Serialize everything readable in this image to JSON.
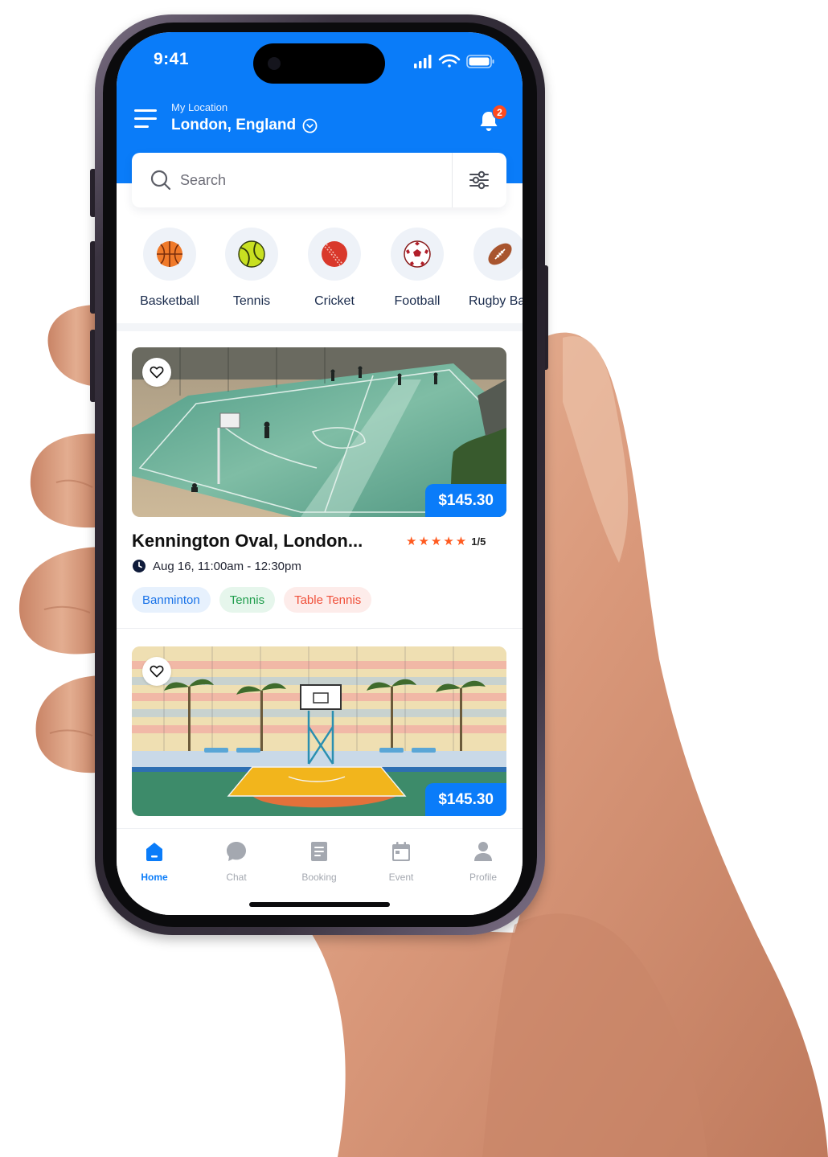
{
  "status_bar": {
    "time": "9:41"
  },
  "header": {
    "location_label": "My Location",
    "location_value": "London, England",
    "notification_count": "2"
  },
  "search": {
    "placeholder": "Search"
  },
  "categories": [
    {
      "label": "Basketball",
      "icon": "basketball-icon"
    },
    {
      "label": "Tennis",
      "icon": "tennis-ball-icon"
    },
    {
      "label": "Cricket",
      "icon": "cricket-ball-icon"
    },
    {
      "label": "Football",
      "icon": "football-icon"
    },
    {
      "label": "Rugby Ba",
      "icon": "rugby-ball-icon"
    }
  ],
  "venues": [
    {
      "price": "$145.30",
      "title": "Kennington Oval, London...",
      "rating": "1/5",
      "stars": 5,
      "time": "Aug 16, 11:00am - 12:30pm",
      "tags": [
        {
          "label": "Banminton",
          "color": "#1a73e8",
          "bg": "#e7f1fd"
        },
        {
          "label": "Tennis",
          "color": "#1f9d4c",
          "bg": "#e6f6ec"
        },
        {
          "label": "Table Tennis",
          "color": "#f0503a",
          "bg": "#fdecea"
        }
      ]
    },
    {
      "price": "$145.30"
    }
  ],
  "nav": [
    {
      "label": "Home",
      "icon": "home-icon",
      "active": true
    },
    {
      "label": "Chat",
      "icon": "chat-icon",
      "active": false
    },
    {
      "label": "Booking",
      "icon": "booking-icon",
      "active": false
    },
    {
      "label": "Event",
      "icon": "calendar-icon",
      "active": false
    },
    {
      "label": "Profile",
      "icon": "profile-icon",
      "active": false
    }
  ],
  "colors": {
    "accent": "#0a7cf9",
    "star": "#ff5a1f",
    "badge": "#ff4b1f"
  }
}
